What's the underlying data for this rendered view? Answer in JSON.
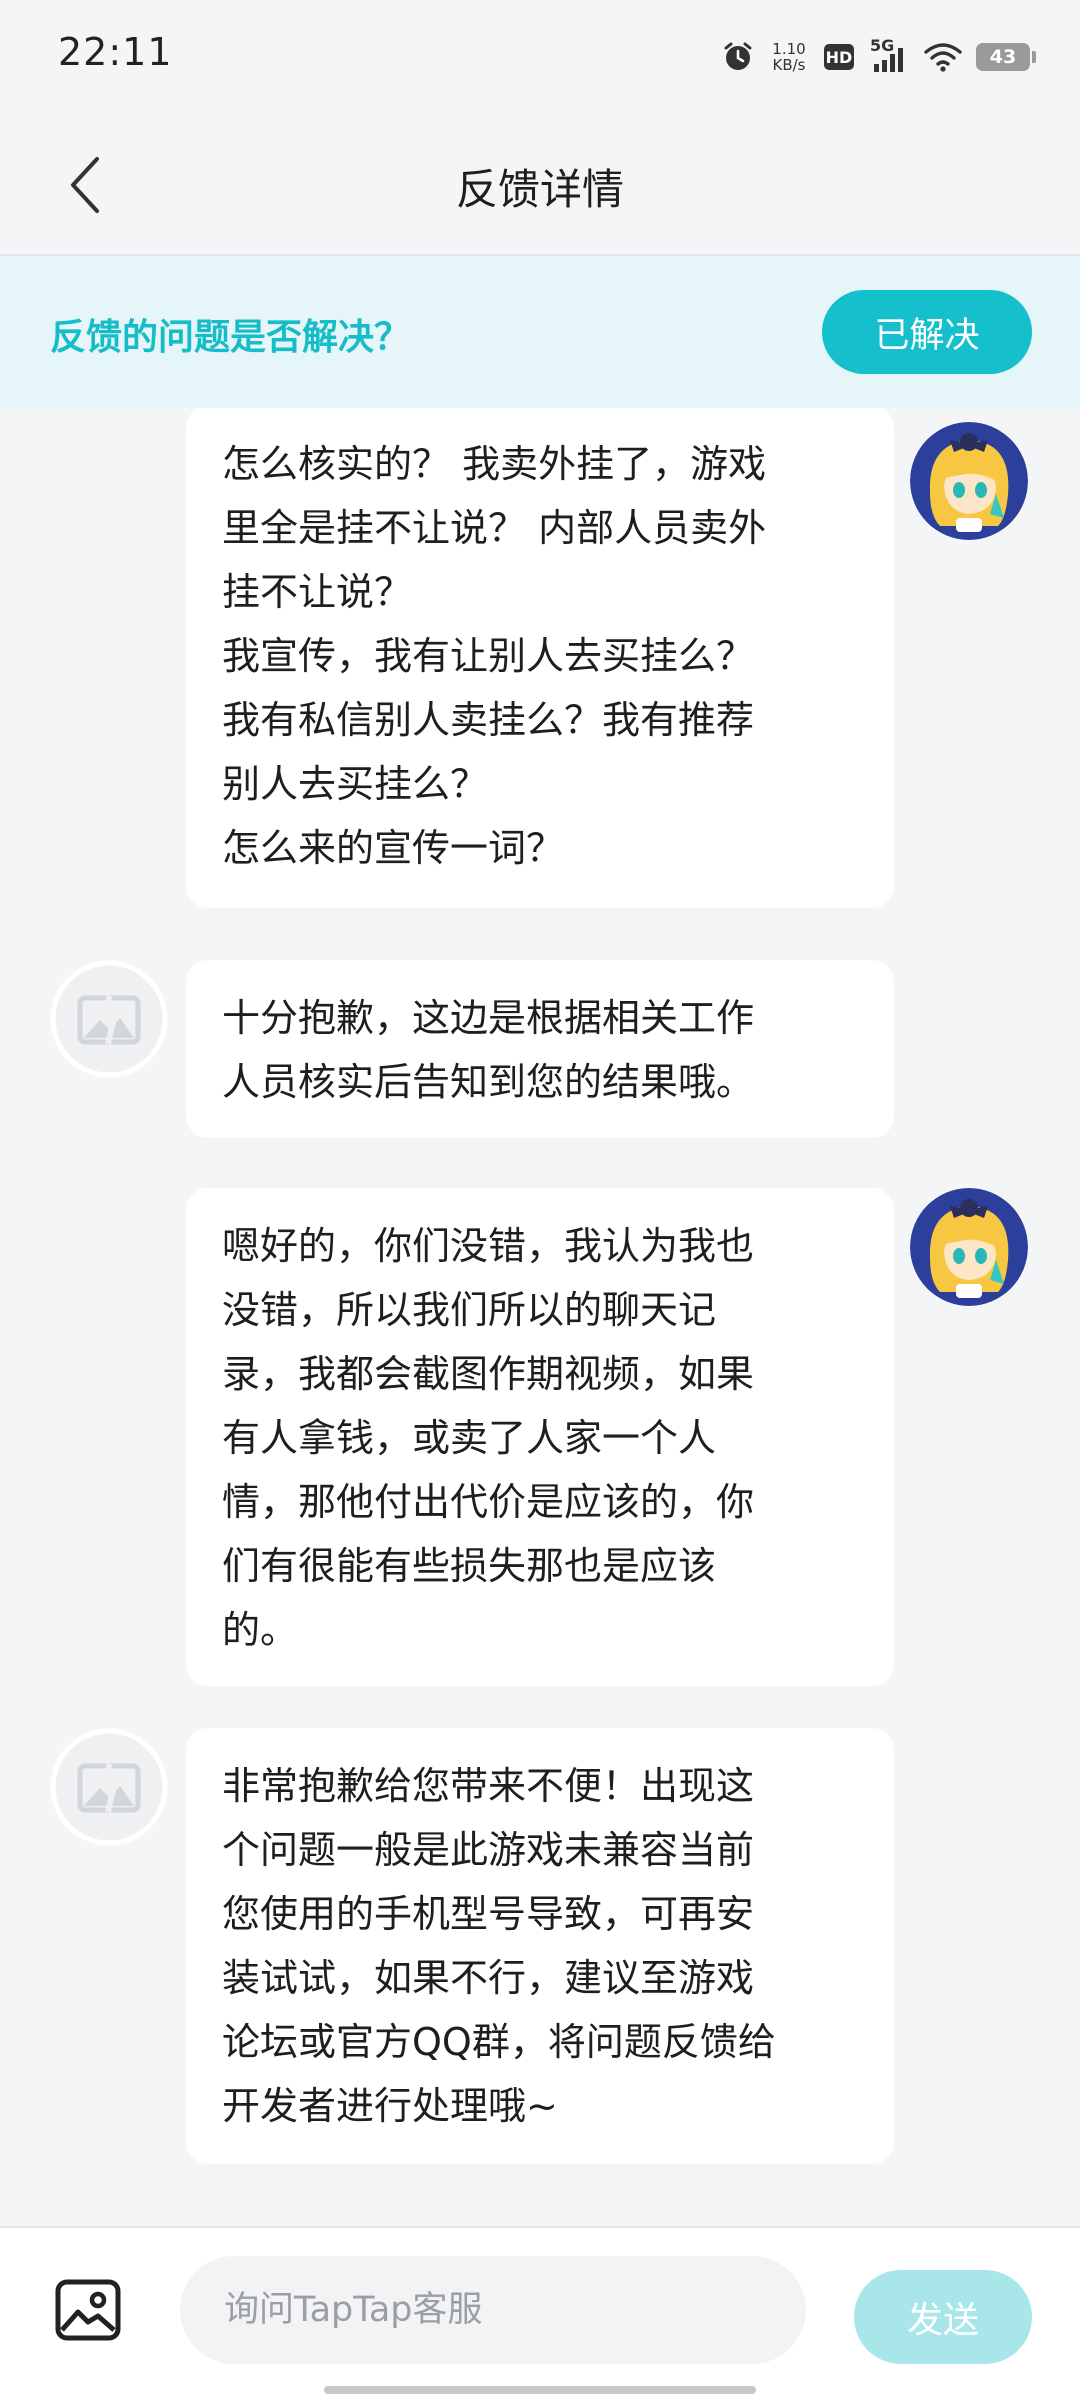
{
  "status_bar": {
    "time": "22:11",
    "net_speed_value": "1.10",
    "net_speed_unit": "KB/s",
    "hd_label": "HD",
    "signal_label": "5G",
    "battery_level": "43"
  },
  "header": {
    "title": "反馈详情",
    "back_icon": "chevron-left-icon"
  },
  "resolve_banner": {
    "question": "反馈的问题是否解决？",
    "button_label": "已解决",
    "accent_color": "#15c0cc",
    "background_color": "#e6f6f8"
  },
  "messages": [
    {
      "sender": "user",
      "text": "怎么核实的？ 我卖外挂了，游戏\n里全是挂不让说？ 内部人员卖外\n挂不让说？\n我宣传，我有让别人去买挂么？\n我有私信别人卖挂么？我有推荐\n别人去买挂么？\n怎么来的宣传一词？"
    },
    {
      "sender": "agent",
      "text": "十分抱歉，这边是根据相关工作\n人员核实后告知到您的结果哦。"
    },
    {
      "sender": "user",
      "text": "嗯好的，你们没错，我认为我也\n没错，所以我们所以的聊天记\n录，我都会截图作期视频，如果\n有人拿钱，或卖了人家一个人\n情，那他付出代价是应该的，你\n们有很能有些损失那也是应该\n的。"
    },
    {
      "sender": "agent",
      "text": "非常抱歉给您带来不便！出现这\n个问题一般是此游戏未兼容当前\n您使用的手机型号导致，可再安\n装试试，如果不行，建议至游戏\n论坛或官方QQ群，将问题反馈给\n开发者进行处理哦~"
    }
  ],
  "input_bar": {
    "placeholder": "询问TapTap客服",
    "value": "",
    "send_label": "发送",
    "image_icon": "image-icon"
  }
}
